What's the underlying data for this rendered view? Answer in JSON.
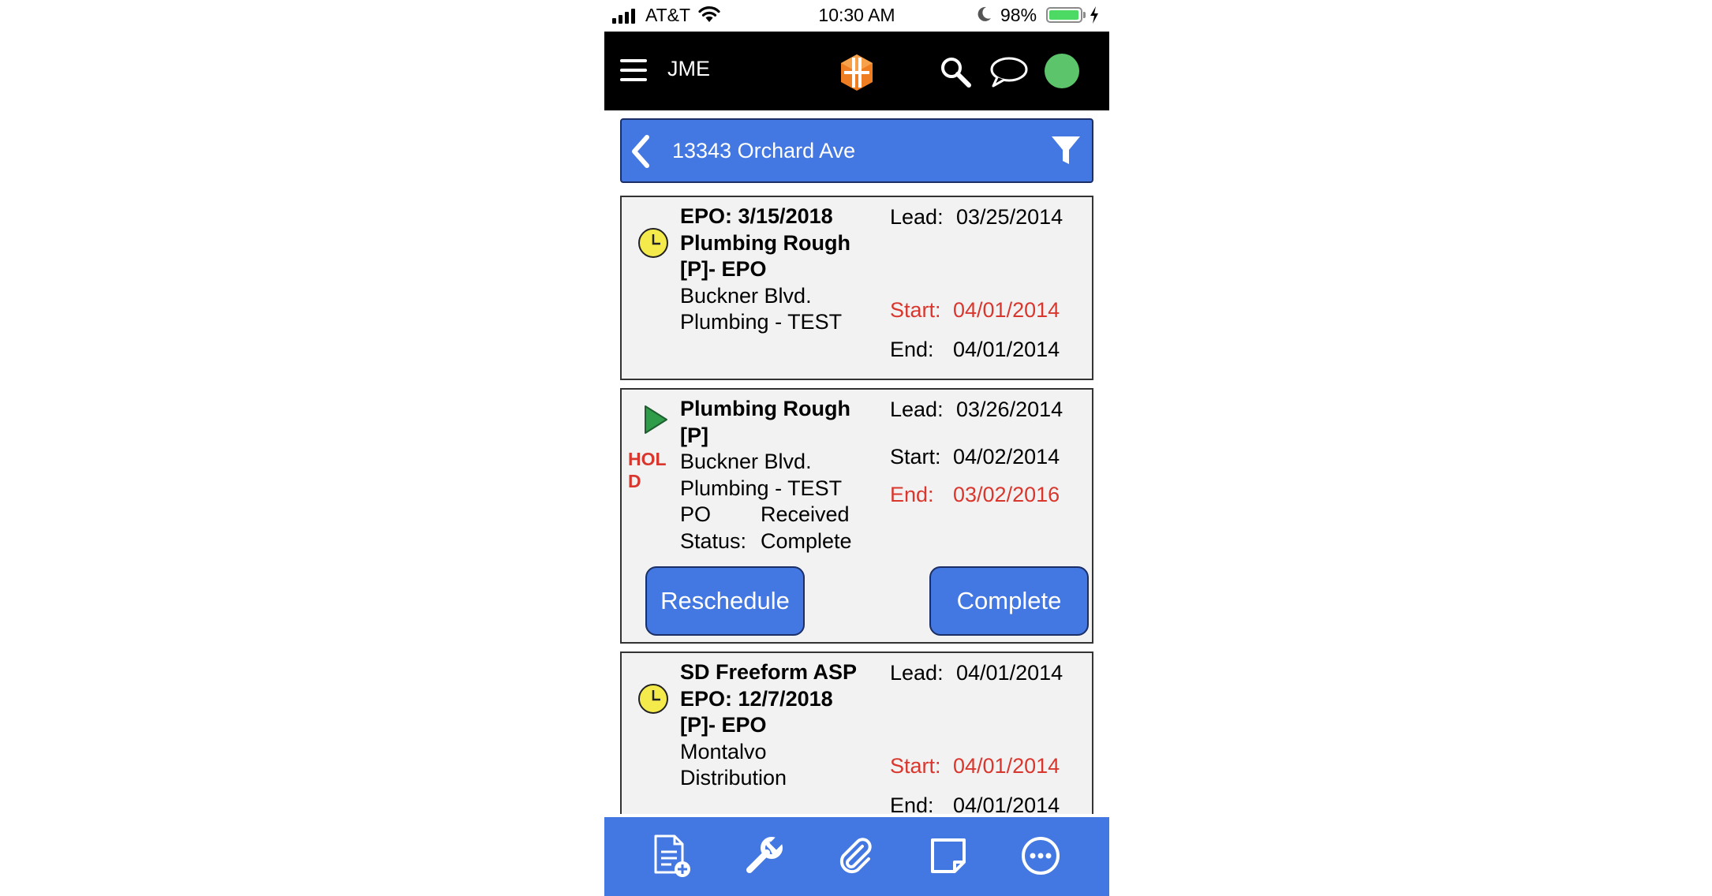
{
  "status_bar": {
    "carrier": "AT&T",
    "time": "10:30 AM",
    "battery_percent": "98%",
    "battery_level": 0.98,
    "icons": [
      "signal-icon",
      "wifi-icon",
      "moon-icon",
      "battery-icon",
      "charging-bolt-icon"
    ]
  },
  "header": {
    "title": "JME",
    "icons": [
      "menu-icon",
      "logo",
      "search-icon",
      "chat-icon",
      "status-dot"
    ],
    "status_color": "#5cc46a"
  },
  "location": {
    "title": "13343 Orchard Ave",
    "icons": [
      "back-chevron-icon",
      "filter-icon"
    ]
  },
  "colors": {
    "accent": "#4377e1",
    "alert": "#d9372e",
    "pending": "#f4ea4c",
    "active": "#2f9c4a"
  },
  "cards": [
    {
      "status_icon": "clock-icon",
      "title_lines": [
        "EPO: 3/15/2018",
        "Plumbing Rough",
        "[P]- EPO"
      ],
      "detail_lines": [
        "Buckner Blvd.",
        "Plumbing - TEST"
      ],
      "lead_label": "Lead:",
      "lead": "03/25/2014",
      "start_label": "Start:",
      "start": "04/01/2014",
      "end_label": "End:",
      "end": "04/01/2014"
    },
    {
      "status_icon": "play-icon",
      "hold": "HOLD",
      "title_lines": [
        "Plumbing Rough",
        "[P]"
      ],
      "detail_lines": [
        "Buckner Blvd.",
        "Plumbing - TEST"
      ],
      "po_label": "PO",
      "po_value": "Received",
      "status_label": "Status:",
      "status_value": "Complete",
      "lead_label": "Lead:",
      "lead": "03/26/2014",
      "start_label": "Start:",
      "start": "04/02/2014",
      "end_label": "End:",
      "end": "03/02/2016",
      "reschedule_label": "Reschedule",
      "complete_label": "Complete"
    },
    {
      "status_icon": "clock-icon",
      "title_lines": [
        "SD Freeform ASP",
        "EPO: 12/7/2018",
        "[P]- EPO"
      ],
      "detail_lines": [
        "Montalvo",
        "Distribution"
      ],
      "lead_label": "Lead:",
      "lead": "04/01/2014",
      "start_label": "Start:",
      "start": "04/01/2014",
      "end_label": "End:",
      "end": "04/01/2014"
    }
  ],
  "toolbar": {
    "icons": [
      "new-document-icon",
      "wrench-icon",
      "paperclip-icon",
      "note-icon",
      "more-icon"
    ]
  }
}
